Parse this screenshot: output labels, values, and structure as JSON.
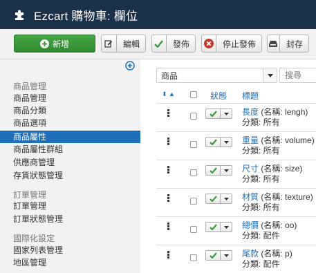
{
  "header": {
    "title": "Ezcart 購物車: 欄位"
  },
  "toolbar": {
    "new_label": "新增",
    "edit_label": "編輯",
    "publish_label": "發佈",
    "unpublish_label": "停止發佈",
    "archive_label": "封存"
  },
  "colors": {
    "header_bg": "#1b3049",
    "new_green": "#3c9a3c",
    "active_blue": "#1e6fb8",
    "unpublish_red": "#c0392b"
  },
  "sidebar": {
    "group1_heading": "商品管理",
    "group1_items": [
      "商品管理",
      "商品分類",
      "商品選項",
      "商品屬性",
      "商品屬性群組",
      "供應商管理",
      "存貨狀態管理"
    ],
    "active_item": "商品屬性",
    "group2_heading": "訂單管理",
    "group2_items": [
      "訂單管理",
      "訂單狀態管理"
    ],
    "group3_heading": "國際化設定",
    "group3_items": [
      "國家列表管理",
      "地區管理"
    ]
  },
  "filters": {
    "category_value": "商品",
    "search_placeholder": "搜尋"
  },
  "table": {
    "columns": {
      "status": "狀態",
      "title": "標題"
    },
    "rows": [
      {
        "name": "長度",
        "meta": "(名稱: lengh)",
        "category": "分類: 所有"
      },
      {
        "name": "重量",
        "meta": "(名稱: volume)",
        "category": "分類: 所有"
      },
      {
        "name": "尺寸",
        "meta": "(名稱: size)",
        "category": "分類: 所有"
      },
      {
        "name": "材質",
        "meta": "(名稱: texture)",
        "category": "分類: 所有"
      },
      {
        "name": "總價",
        "meta": "(名稱: oo)",
        "category": "分類: 配件"
      },
      {
        "name": "尾款",
        "meta": "(名稱: p)",
        "category": "分類: 配件"
      }
    ]
  }
}
